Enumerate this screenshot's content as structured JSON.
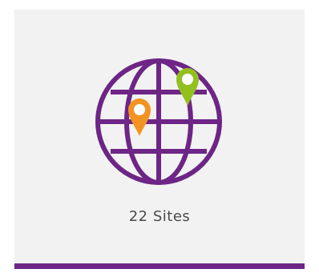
{
  "stat": {
    "label": "22 Sites",
    "icon": "globe-with-location-pins-icon"
  },
  "colors": {
    "card_background": "#f2f2f2",
    "accent_purple": "#6d2586",
    "pin_orange": "#f39322",
    "pin_green": "#93c01f",
    "text": "#4a4a4a"
  }
}
